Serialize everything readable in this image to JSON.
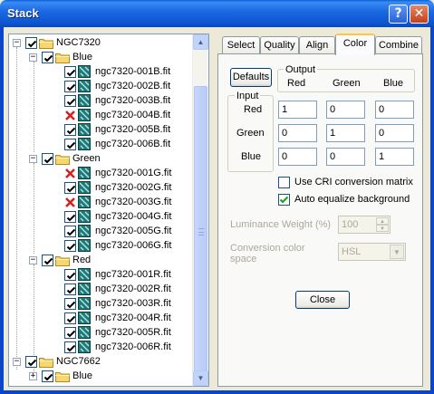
{
  "window": {
    "title": "Stack",
    "help_label": "?",
    "close_label": "✕"
  },
  "tree": {
    "nodes": [
      {
        "label": "NGC7320",
        "expander": "−",
        "level": 0,
        "type": "group",
        "checked": true
      },
      {
        "label": "Blue",
        "expander": "−",
        "level": 1,
        "type": "folder",
        "checked": true
      },
      {
        "label": "ngc7320-001B.fit",
        "level": 2,
        "type": "file",
        "status": "checked"
      },
      {
        "label": "ngc7320-002B.fit",
        "level": 2,
        "type": "file",
        "status": "checked"
      },
      {
        "label": "ngc7320-003B.fit",
        "level": 2,
        "type": "file",
        "status": "checked"
      },
      {
        "label": "ngc7320-004B.fit",
        "level": 2,
        "type": "file",
        "status": "excluded"
      },
      {
        "label": "ngc7320-005B.fit",
        "level": 2,
        "type": "file",
        "status": "checked"
      },
      {
        "label": "ngc7320-006B.fit",
        "level": 2,
        "type": "file",
        "status": "checked"
      },
      {
        "label": "Green",
        "expander": "−",
        "level": 1,
        "type": "folder",
        "checked": true
      },
      {
        "label": "ngc7320-001G.fit",
        "level": 2,
        "type": "file",
        "status": "excluded"
      },
      {
        "label": "ngc7320-002G.fit",
        "level": 2,
        "type": "file",
        "status": "checked"
      },
      {
        "label": "ngc7320-003G.fit",
        "level": 2,
        "type": "file",
        "status": "excluded"
      },
      {
        "label": "ngc7320-004G.fit",
        "level": 2,
        "type": "file",
        "status": "checked"
      },
      {
        "label": "ngc7320-005G.fit",
        "level": 2,
        "type": "file",
        "status": "checked"
      },
      {
        "label": "ngc7320-006G.fit",
        "level": 2,
        "type": "file",
        "status": "checked"
      },
      {
        "label": "Red",
        "expander": "−",
        "level": 1,
        "type": "folder",
        "checked": true
      },
      {
        "label": "ngc7320-001R.fit",
        "level": 2,
        "type": "file",
        "status": "checked"
      },
      {
        "label": "ngc7320-002R.fit",
        "level": 2,
        "type": "file",
        "status": "checked"
      },
      {
        "label": "ngc7320-003R.fit",
        "level": 2,
        "type": "file",
        "status": "checked"
      },
      {
        "label": "ngc7320-004R.fit",
        "level": 2,
        "type": "file",
        "status": "checked"
      },
      {
        "label": "ngc7320-005R.fit",
        "level": 2,
        "type": "file",
        "status": "checked"
      },
      {
        "label": "ngc7320-006R.fit",
        "level": 2,
        "type": "file",
        "status": "checked"
      },
      {
        "label": "NGC7662",
        "expander": "−",
        "level": 0,
        "type": "group",
        "checked": true
      },
      {
        "label": "Blue",
        "expander": "+",
        "level": 1,
        "type": "folder",
        "checked": true
      }
    ]
  },
  "tabs": [
    {
      "label": "Select",
      "active": false
    },
    {
      "label": "Quality",
      "active": false
    },
    {
      "label": "Align",
      "active": false
    },
    {
      "label": "Color",
      "active": true
    },
    {
      "label": "Combine",
      "active": false
    }
  ],
  "color_tab": {
    "defaults_label": "Defaults",
    "output_label": "Output",
    "input_label": "Input",
    "output_cols": [
      "Red",
      "Green",
      "Blue"
    ],
    "input_rows": [
      "Red",
      "Green",
      "Blue"
    ],
    "matrix": [
      [
        "1",
        "0",
        "0"
      ],
      [
        "0",
        "1",
        "0"
      ],
      [
        "0",
        "0",
        "1"
      ]
    ],
    "cri_label": "Use CRI conversion matrix",
    "cri_checked": false,
    "auto_eq_label": "Auto equalize background",
    "auto_eq_checked": true,
    "luminance_label": "Luminance Weight (%)",
    "luminance_value": "100",
    "conversion_label_1": "Conversion color",
    "conversion_label_2": "space",
    "conversion_value": "HSL",
    "close_label": "Close"
  },
  "colors": {
    "titlebar": "#0D55D1",
    "folder": "#F5D76E",
    "excluded": "#D42020",
    "file_icon": "#1F7A7A",
    "tab_highlight": "#FFC83C"
  },
  "icons": {
    "folder": "folder-icon",
    "file": "fits-file-icon",
    "excluded": "red-x-icon",
    "check": "checkmark-icon"
  }
}
